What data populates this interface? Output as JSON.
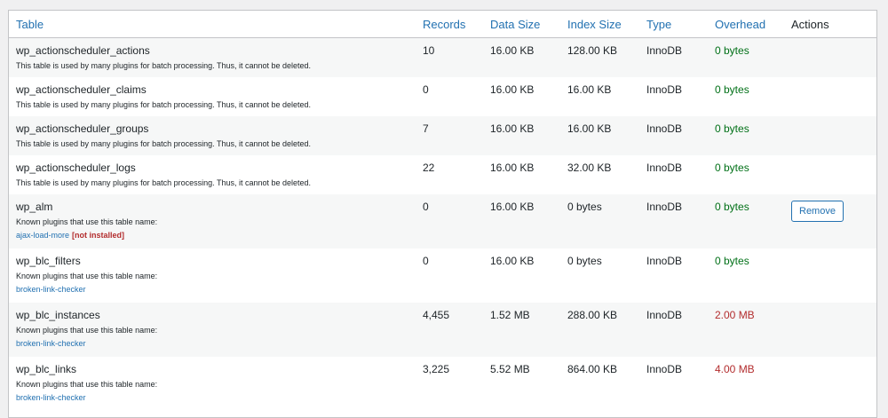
{
  "headers": {
    "table": "Table",
    "records": "Records",
    "data_size": "Data Size",
    "index_size": "Index Size",
    "type": "Type",
    "overhead": "Overhead",
    "actions": "Actions"
  },
  "rows": [
    {
      "name": "wp_actionscheduler_actions",
      "description": "This table is used by many plugins for batch processing. Thus, it cannot be deleted.",
      "records": "10",
      "data_size": "16.00 KB",
      "index_size": "128.00 KB",
      "type": "InnoDB",
      "overhead": "0 bytes"
    },
    {
      "name": "wp_actionscheduler_claims",
      "description": "This table is used by many plugins for batch processing. Thus, it cannot be deleted.",
      "records": "0",
      "data_size": "16.00 KB",
      "index_size": "16.00 KB",
      "type": "InnoDB",
      "overhead": "0 bytes"
    },
    {
      "name": "wp_actionscheduler_groups",
      "description": "This table is used by many plugins for batch processing. Thus, it cannot be deleted.",
      "records": "7",
      "data_size": "16.00 KB",
      "index_size": "16.00 KB",
      "type": "InnoDB",
      "overhead": "0 bytes"
    },
    {
      "name": "wp_actionscheduler_logs",
      "description": "This table is used by many plugins for batch processing. Thus, it cannot be deleted.",
      "records": "22",
      "data_size": "16.00 KB",
      "index_size": "32.00 KB",
      "type": "InnoDB",
      "overhead": "0 bytes"
    },
    {
      "name": "wp_alm",
      "description": "Known plugins that use this table name:",
      "plugin": "ajax-load-more",
      "plugin_status": "[not installed]",
      "records": "0",
      "data_size": "16.00 KB",
      "index_size": "0 bytes",
      "type": "InnoDB",
      "overhead": "0 bytes",
      "action": "Remove"
    },
    {
      "name": "wp_blc_filters",
      "description": "Known plugins that use this table name:",
      "plugin": "broken-link-checker",
      "records": "0",
      "data_size": "16.00 KB",
      "index_size": "0 bytes",
      "type": "InnoDB",
      "overhead": "0 bytes"
    },
    {
      "name": "wp_blc_instances",
      "description": "Known plugins that use this table name:",
      "plugin": "broken-link-checker",
      "records": "4,455",
      "data_size": "1.52 MB",
      "index_size": "288.00 KB",
      "type": "InnoDB",
      "overhead": "2.00 MB"
    },
    {
      "name": "wp_blc_links",
      "description": "Known plugins that use this table name:",
      "plugin": "broken-link-checker",
      "records": "3,225",
      "data_size": "5.52 MB",
      "index_size": "864.00 KB",
      "type": "InnoDB",
      "overhead": "4.00 MB"
    }
  ],
  "colors": {
    "ok": "#007017",
    "overhead_warning": "#b32d2e",
    "link": "#2271b1"
  }
}
